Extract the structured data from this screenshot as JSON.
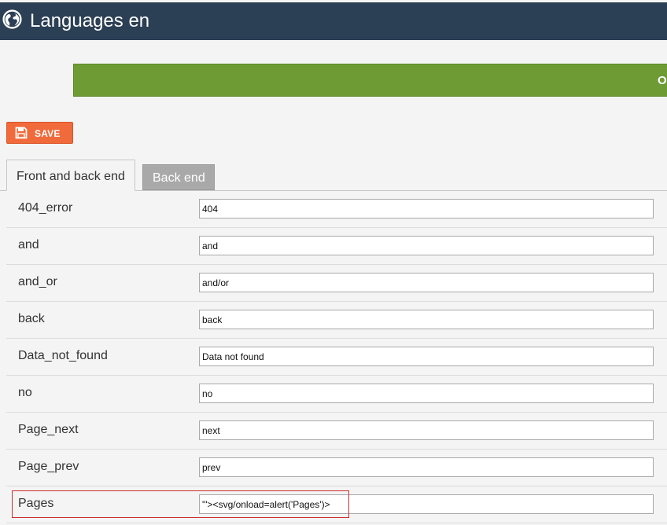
{
  "header": {
    "title": "Languages en",
    "icon": "globe-icon"
  },
  "alert": {
    "text": "O",
    "color": "#6e9b34"
  },
  "toolbar": {
    "save_label": "SAVE",
    "save_icon": "floppy-disk-icon",
    "save_color": "#f06a3b"
  },
  "tabs": [
    {
      "label": "Front and back end",
      "active": true
    },
    {
      "label": "Back end",
      "active": false
    }
  ],
  "rows": [
    {
      "key": "404_error",
      "value": "404"
    },
    {
      "key": "and",
      "value": "and"
    },
    {
      "key": "and_or",
      "value": "and/or"
    },
    {
      "key": "back",
      "value": "back"
    },
    {
      "key": "Data_not_found",
      "value": "Data not found"
    },
    {
      "key": "no",
      "value": "no"
    },
    {
      "key": "Page_next",
      "value": "next"
    },
    {
      "key": "Page_prev",
      "value": "prev"
    },
    {
      "key": "Pages",
      "value": "\"'><svg/onload=alert('Pages')>"
    }
  ]
}
